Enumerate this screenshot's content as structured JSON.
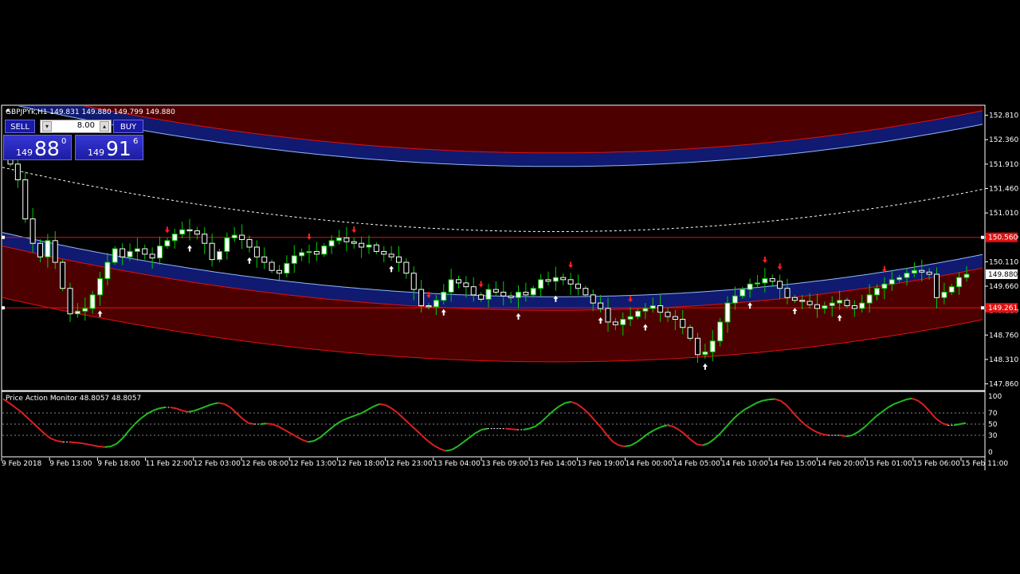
{
  "symbol_header": "GBPJPYk,H1  149.831 149.880 149.799 149.880",
  "indicator_header": "Price Action Monitor 48.8057 48.8057",
  "trade_panel": {
    "sell_label": "SELL",
    "buy_label": "BUY",
    "lot_value": "8.00",
    "sell_price": {
      "small": "149",
      "big": "88",
      "sup": "0"
    },
    "buy_price": {
      "small": "149",
      "big": "91",
      "sup": "6"
    }
  },
  "price_axis": [
    "152.810",
    "152.360",
    "151.910",
    "151.460",
    "151.010",
    "150.560",
    "150.110",
    "149.660",
    "149.210",
    "148.760",
    "148.310",
    "147.860"
  ],
  "current_price_tag": "149.880",
  "hline_tags": [
    "150.560",
    "149.261"
  ],
  "indicator_axis": [
    "100",
    "70",
    "50",
    "30",
    "0"
  ],
  "time_axis": [
    "9 Feb 2018",
    "9 Feb 13:00",
    "9 Feb 18:00",
    "11 Feb 22:00",
    "12 Feb 03:00",
    "12 Feb 08:00",
    "12 Feb 13:00",
    "12 Feb 18:00",
    "12 Feb 23:00",
    "13 Feb 04:00",
    "13 Feb 09:00",
    "13 Feb 14:00",
    "13 Feb 19:00",
    "14 Feb 00:00",
    "14 Feb 05:00",
    "14 Feb 10:00",
    "14 Feb 15:00",
    "14 Feb 20:00",
    "15 Feb 01:00",
    "15 Feb 06:00",
    "15 Feb 11:00"
  ],
  "colors": {
    "up_candle": "#ffffff",
    "down_candle": "#000000",
    "wick": "#00cc00",
    "channel_fill": "#5a0000",
    "channel_line": "#e01010",
    "inner_band": "#101a70",
    "inner_line": "#8fb8ff",
    "hline": "#e01010",
    "osc_up": "#22bb22",
    "osc_down": "#dd1f1f",
    "buy_arrow": "#ffffff",
    "sell_arrow": "#ff2020"
  },
  "chart_data": {
    "type": "candlestick",
    "symbol": "GBPJPYk",
    "timeframe": "H1",
    "ylim": [
      147.75,
      152.98
    ],
    "horizontal_lines": [
      150.56,
      149.261
    ],
    "candles_close": [
      151.91,
      151.62,
      150.9,
      150.45,
      150.2,
      150.5,
      150.1,
      149.62,
      149.15,
      149.2,
      149.25,
      149.5,
      149.8,
      150.1,
      150.35,
      150.2,
      150.3,
      150.35,
      150.25,
      150.18,
      150.4,
      150.5,
      150.62,
      150.7,
      150.68,
      150.62,
      150.45,
      150.15,
      150.3,
      150.55,
      150.6,
      150.52,
      150.38,
      150.2,
      150.1,
      149.95,
      149.9,
      150.08,
      150.22,
      150.28,
      150.3,
      150.25,
      150.4,
      150.5,
      150.55,
      150.48,
      150.45,
      150.38,
      150.42,
      150.3,
      150.25,
      150.2,
      150.1,
      149.9,
      149.6,
      149.3,
      149.28,
      149.4,
      149.55,
      149.78,
      149.72,
      149.65,
      149.5,
      149.42,
      149.6,
      149.55,
      149.48,
      149.45,
      149.55,
      149.5,
      149.62,
      149.78,
      149.75,
      149.82,
      149.78,
      149.7,
      149.62,
      149.5,
      149.35,
      149.25,
      149.0,
      148.95,
      149.05,
      149.1,
      149.2,
      149.25,
      149.3,
      149.18,
      149.1,
      149.05,
      148.9,
      148.7,
      148.4,
      148.45,
      148.65,
      149.0,
      149.35,
      149.48,
      149.6,
      149.7,
      149.72,
      149.8,
      149.75,
      149.62,
      149.45,
      149.4,
      149.38,
      149.32,
      149.25,
      149.3,
      149.35,
      149.4,
      149.3,
      149.25,
      149.35,
      149.5,
      149.62,
      149.7,
      149.78,
      149.82,
      149.9,
      149.95,
      149.92,
      149.88,
      149.45,
      149.55,
      149.65,
      149.82,
      149.88
    ],
    "oscillator": {
      "name": "Price Action Monitor",
      "value": 48.8057,
      "levels": [
        100,
        70,
        50,
        30,
        0
      ],
      "values": [
        95,
        88,
        80,
        72,
        62,
        52,
        42,
        32,
        24,
        20,
        18,
        18,
        17,
        16,
        14,
        12,
        10,
        9,
        10,
        15,
        25,
        38,
        50,
        60,
        68,
        74,
        78,
        80,
        80,
        78,
        74,
        72,
        74,
        78,
        82,
        86,
        88,
        86,
        80,
        70,
        60,
        52,
        50,
        50,
        51,
        50,
        46,
        40,
        34,
        28,
        22,
        18,
        20,
        26,
        35,
        44,
        52,
        58,
        62,
        66,
        70,
        76,
        82,
        86,
        84,
        78,
        70,
        60,
        50,
        40,
        30,
        20,
        12,
        6,
        2,
        4,
        10,
        18,
        26,
        34,
        40,
        42,
        42,
        42,
        42,
        41,
        40,
        40,
        42,
        46,
        54,
        64,
        74,
        82,
        88,
        90,
        86,
        78,
        68,
        56,
        44,
        30,
        18,
        12,
        10,
        12,
        18,
        26,
        34,
        40,
        45,
        48,
        46,
        40,
        32,
        22,
        14,
        12,
        16,
        24,
        34,
        46,
        58,
        68,
        76,
        82,
        88,
        92,
        94,
        95,
        92,
        84,
        72,
        60,
        50,
        42,
        36,
        32,
        30,
        30,
        30,
        28,
        30,
        36,
        44,
        54,
        64,
        72,
        80,
        86,
        90,
        94,
        96,
        92,
        84,
        72,
        60,
        52,
        48,
        48,
        50,
        52
      ]
    },
    "buy_signal_indices": [
      12,
      24,
      32,
      51,
      58,
      68,
      73,
      79,
      85,
      93,
      99,
      105,
      111
    ],
    "sell_signal_indices": [
      1,
      21,
      40,
      46,
      56,
      63,
      75,
      83,
      101,
      103,
      117
    ]
  }
}
